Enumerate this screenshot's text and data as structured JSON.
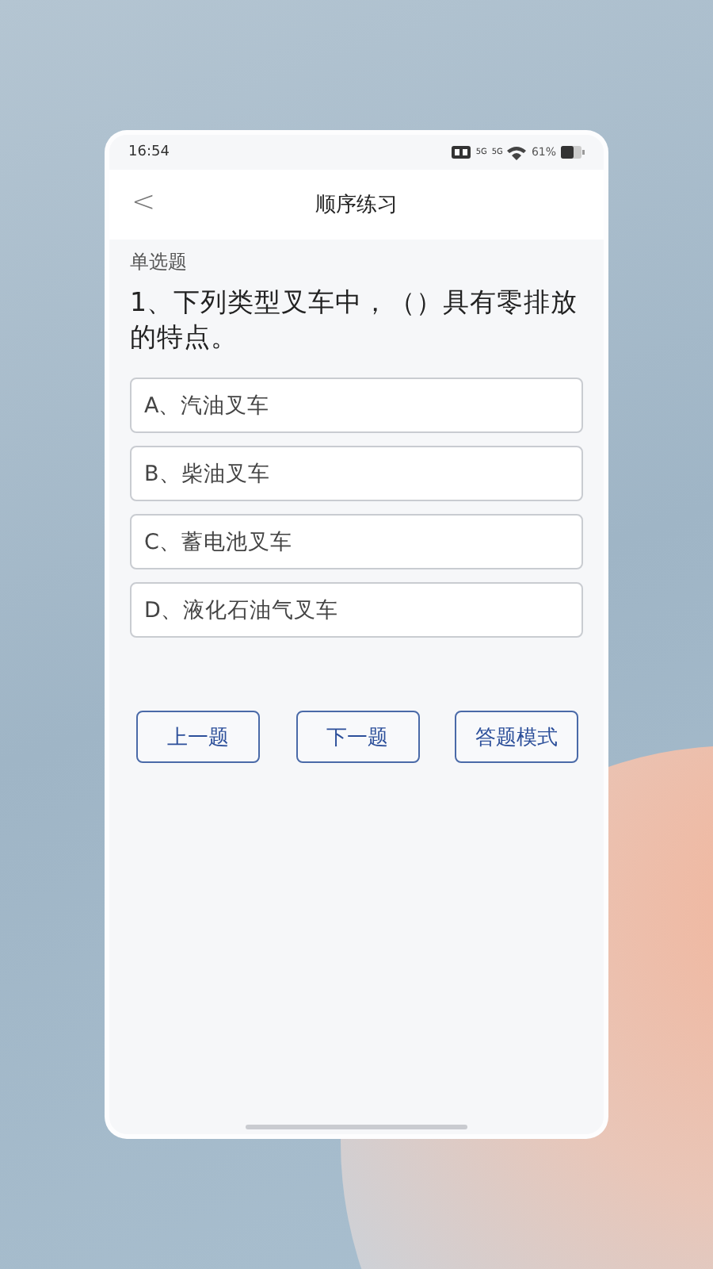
{
  "status_bar": {
    "time": "16:54",
    "signal_labels": [
      "5G",
      "5G"
    ],
    "battery": "61%"
  },
  "header": {
    "back": "<",
    "title": "顺序练习"
  },
  "question": {
    "type": "单选题",
    "text": "1、下列类型叉车中，（）具有零排放的特点。"
  },
  "options": [
    {
      "label": "A、汽油叉车"
    },
    {
      "label": "B、柴油叉车"
    },
    {
      "label": "C、蓄电池叉车"
    },
    {
      "label": "D、液化石油气叉车"
    }
  ],
  "buttons": [
    "上一题",
    "下一题",
    "答题模式"
  ]
}
